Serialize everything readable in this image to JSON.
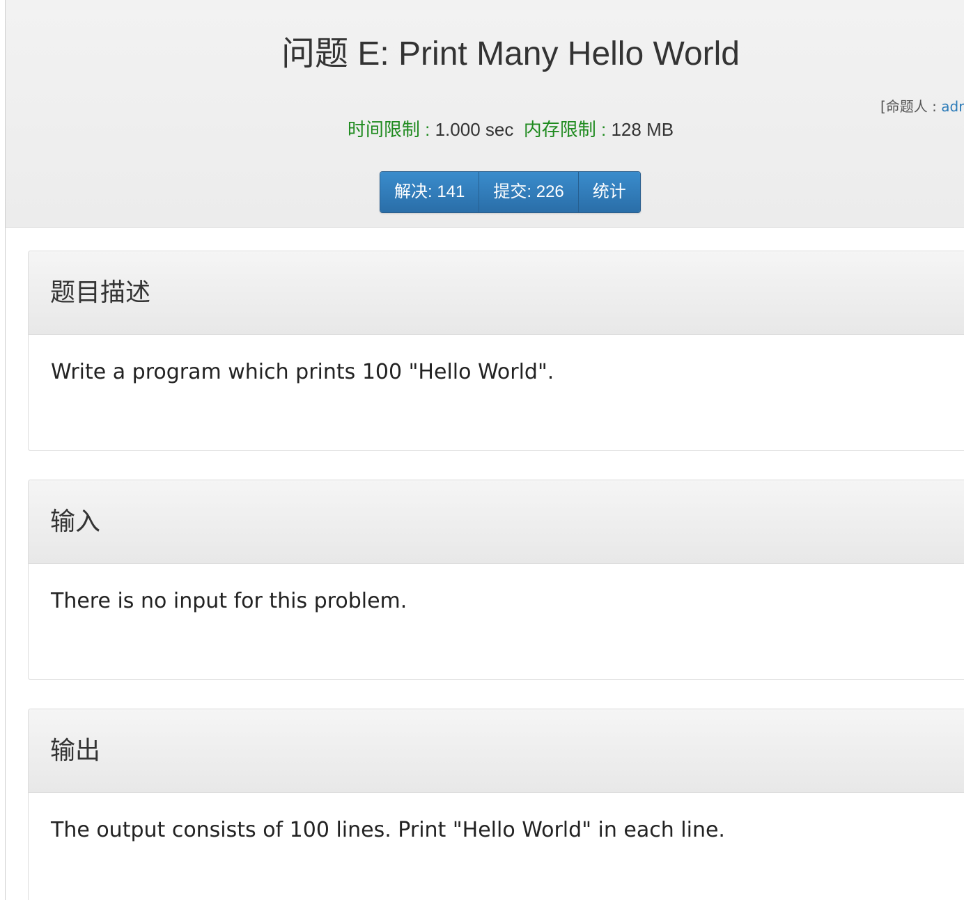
{
  "header": {
    "title": "问题 E: Print Many Hello World",
    "setter_label": "[命题人 : ",
    "setter_name": "adm",
    "time_limit_label": "时间限制 : ",
    "time_limit_value": "1.000 sec",
    "memory_limit_label": "内存限制 : ",
    "memory_limit_value": "128 MB"
  },
  "buttons": {
    "solved": "解决: 141",
    "submitted": "提交: 226",
    "stats": "统计"
  },
  "sections": {
    "description": {
      "title": "题目描述",
      "body": "Write a program which prints 100 \"Hello World\"."
    },
    "input": {
      "title": "输入",
      "body": "There is no input for this problem."
    },
    "output": {
      "title": "输出",
      "body": "The output consists of 100 lines. Print \"Hello World\" in each line."
    }
  },
  "colors": {
    "limit_label": "#1e8a1e",
    "button_bg": "#2a6ea8",
    "link": "#2a7ab8"
  }
}
